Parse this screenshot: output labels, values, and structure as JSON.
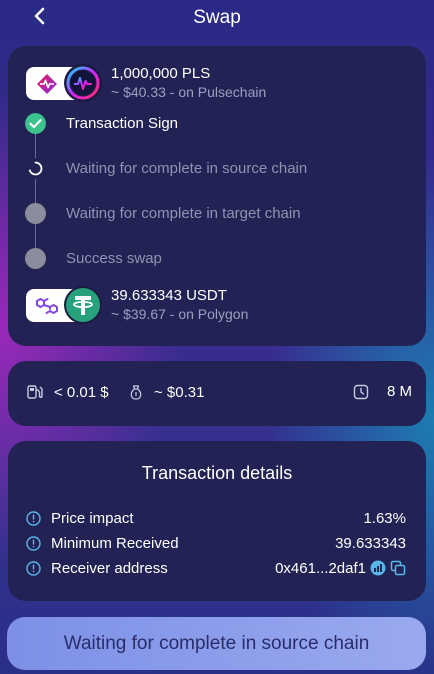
{
  "header": {
    "title": "Swap"
  },
  "source_token": {
    "amount": "1,000,000 PLS",
    "value": "~ $40.33 - on Pulsechain"
  },
  "target_token": {
    "amount": "39.633343 USDT",
    "value": "~ $39.67 - on Polygon"
  },
  "steps": [
    {
      "label": "Transaction Sign",
      "status": "done"
    },
    {
      "label": "Waiting for complete in source chain",
      "status": "in-progress"
    },
    {
      "label": "Waiting for complete in target chain",
      "status": "pending"
    },
    {
      "label": "Success swap",
      "status": "pending"
    }
  ],
  "stats": {
    "gas_fee": "< 0.01 $",
    "bridge_fee": "~ $0.31",
    "time": "8 M"
  },
  "details": {
    "title": "Transaction details",
    "price_impact_label": "Price impact",
    "price_impact_value": "1.63%",
    "min_received_label": "Minimum Received",
    "min_received_value": "39.633343",
    "receiver_label": "Receiver address",
    "receiver_value": "0x461...2daf1"
  },
  "action_button": {
    "label": "Waiting for complete in source chain"
  },
  "colors": {
    "card": "#222255",
    "success": "#3cc28c",
    "pending": "#8b8d9c",
    "muted_text": "#9aa0bf",
    "info": "#58b6e8"
  },
  "icons": [
    "back-arrow-icon",
    "pulsechain-icon",
    "pls-token-icon",
    "polygon-icon",
    "usdt-icon",
    "gas-pump-icon",
    "fee-bag-icon",
    "timer-icon",
    "info-icon",
    "explorer-icon",
    "copy-icon"
  ]
}
